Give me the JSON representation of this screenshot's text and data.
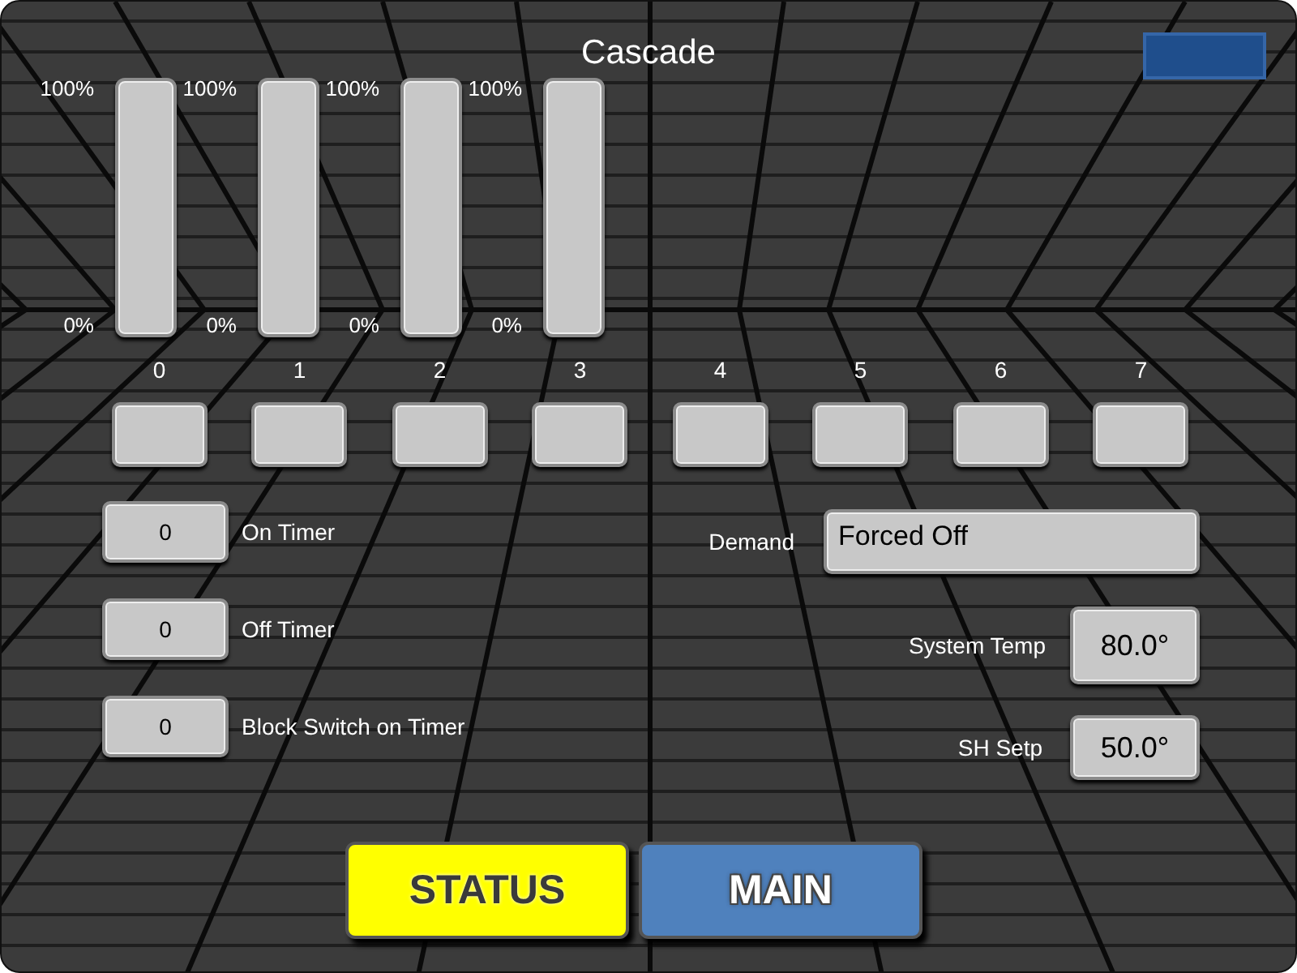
{
  "title": "Cascade",
  "gauges": [
    {
      "top_label": "100%",
      "bottom_label": "0%",
      "level": 0
    },
    {
      "top_label": "100%",
      "bottom_label": "0%",
      "level": 0
    },
    {
      "top_label": "100%",
      "bottom_label": "0%",
      "level": 0
    },
    {
      "top_label": "100%",
      "bottom_label": "0%",
      "level": 0
    }
  ],
  "stages": [
    {
      "label": "0"
    },
    {
      "label": "1"
    },
    {
      "label": "2"
    },
    {
      "label": "3"
    },
    {
      "label": "4"
    },
    {
      "label": "5"
    },
    {
      "label": "6"
    },
    {
      "label": "7"
    }
  ],
  "timers": [
    {
      "value": "0",
      "label": "On Timer"
    },
    {
      "value": "0",
      "label": "Off Timer"
    },
    {
      "value": "0",
      "label": "Block Switch on Timer"
    }
  ],
  "demand": {
    "label": "Demand",
    "value": "Forced Off"
  },
  "readings": [
    {
      "label": "System Temp",
      "value": "80.0°"
    },
    {
      "label": "SH Setp",
      "value": "50.0°"
    }
  ],
  "buttons": [
    {
      "label": "STATUS",
      "color": "#ffff00"
    },
    {
      "label": "MAIN",
      "color": "#4f81bd"
    }
  ]
}
